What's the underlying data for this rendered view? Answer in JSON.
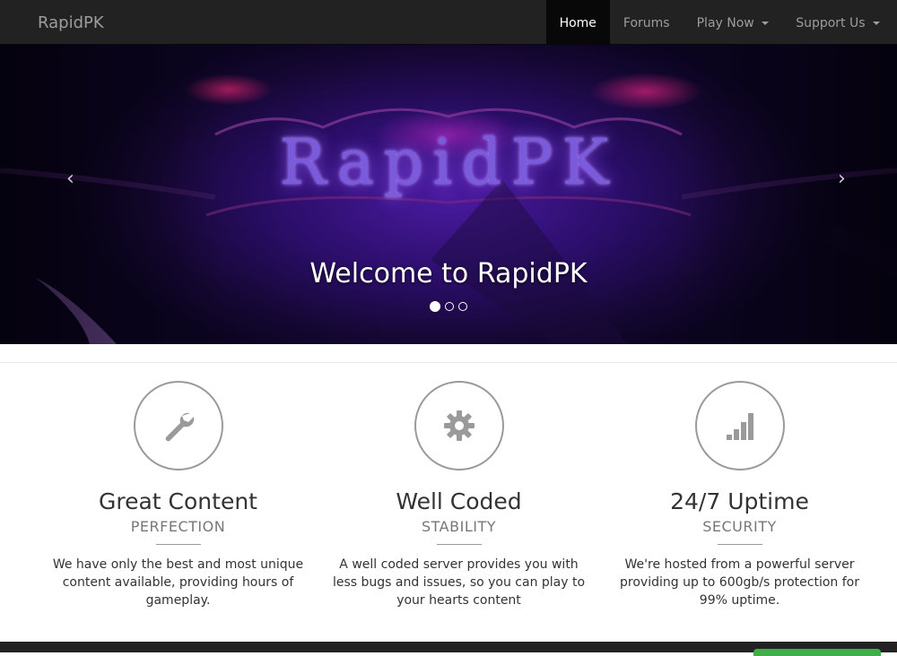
{
  "navbar": {
    "brand": "RapidPK",
    "items": [
      {
        "label": "Home",
        "active": true,
        "dropdown": false
      },
      {
        "label": "Forums",
        "active": false,
        "dropdown": false
      },
      {
        "label": "Play Now",
        "active": false,
        "dropdown": true
      },
      {
        "label": "Support Us",
        "active": false,
        "dropdown": true
      }
    ]
  },
  "carousel": {
    "banner_logo": "RapidPK",
    "caption": "Welcome to RapidPK",
    "slide_count": 3,
    "active_slide": 1,
    "prev_icon": "chevron-left-icon",
    "next_icon": "chevron-right-icon",
    "prev_glyph": "‹",
    "next_glyph": "›"
  },
  "features": [
    {
      "icon": "wrench-icon",
      "title": "Great Content",
      "subtitle": "PERFECTION",
      "text": "We have only the best and most unique content available, providing hours of gameplay."
    },
    {
      "icon": "gear-icon",
      "title": "Well Coded",
      "subtitle": "STABILITY",
      "text": "A well coded server provides you with less bugs and issues, so you can play to your hearts content"
    },
    {
      "icon": "signal-icon",
      "title": "24/7 Uptime",
      "subtitle": "SECURITY",
      "text": "We're hosted from a powerful server providing up to 600gb/s protection for 99% uptime."
    }
  ],
  "colors": {
    "navbar_bg": "#222222",
    "nav_active_bg": "#080808",
    "icon_gray": "#9a9a9a",
    "footer_button": "#3fae49"
  }
}
